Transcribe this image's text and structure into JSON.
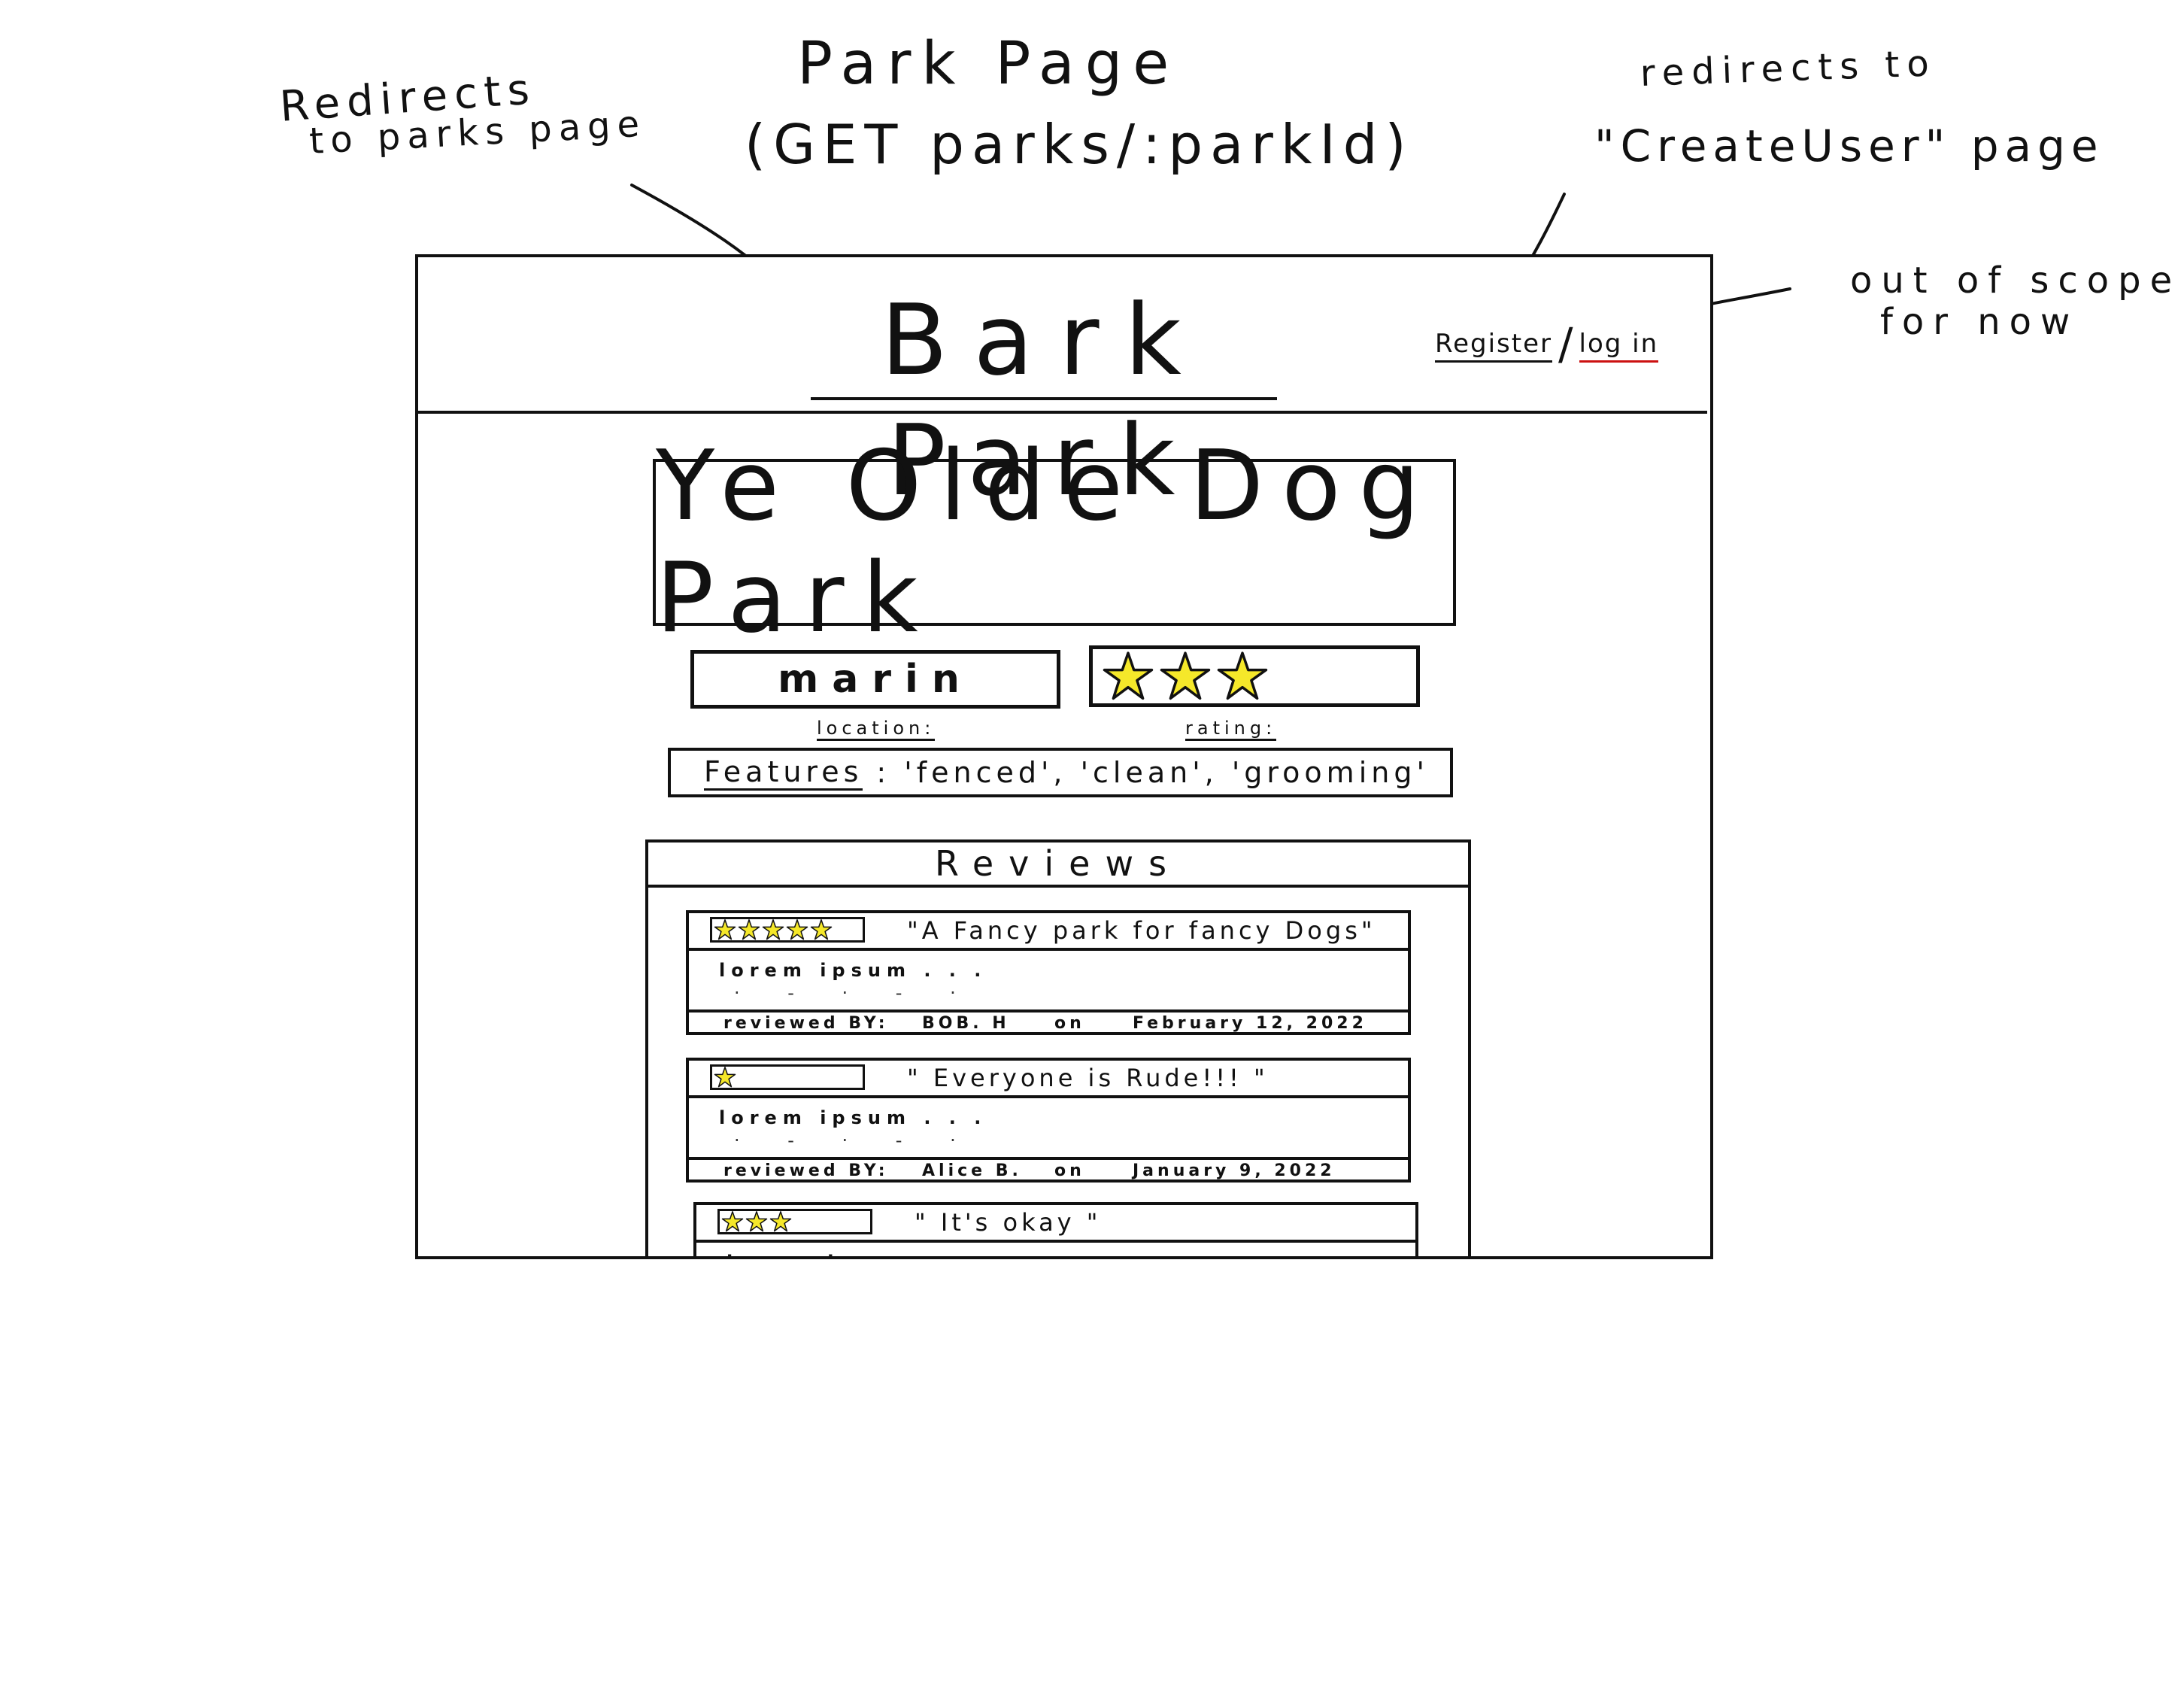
{
  "annotations": {
    "title_line1": "Park Page",
    "title_line2": "(GET parks/:parkId)",
    "left_line1": "Redirects",
    "left_line2": "to parks page",
    "right_line1": "redirects to",
    "right_line2": "\"CreateUser\" page",
    "scope_line1": "out of scope",
    "scope_line2": "for now"
  },
  "header": {
    "site_title": "Bark Park",
    "register_label": "Register",
    "separator": "/",
    "login_label": "log in",
    "login_underline_color": "#cc1111"
  },
  "park": {
    "name": "Ye Olde Dog Park",
    "location_value": "marin",
    "location_label": "location:",
    "rating_value": 3,
    "rating_label": "rating:",
    "features_label": "Features",
    "features_value": ": 'fenced', 'clean', 'grooming'"
  },
  "reviews": {
    "heading": "Reviews",
    "items": [
      {
        "stars": 5,
        "title": "\"A Fancy park for fancy Dogs\"",
        "body": "lorem ipsum . . .",
        "reviewed_by_label": "reviewed BY:",
        "author": "BOB. H",
        "on_label": "on",
        "date": "February 12, 2022"
      },
      {
        "stars": 1,
        "title": "\" Everyone is Rude!!! \"",
        "body": "lorem ipsum . . .",
        "reviewed_by_label": "reviewed BY:",
        "author": "Alice B.",
        "on_label": "on",
        "date": "January 9, 2022"
      },
      {
        "stars": 3,
        "title": "\" It's okay \"",
        "body": "lorem ipsum . . ."
      }
    ]
  },
  "colors": {
    "star_fill": "#f5e82a",
    "ink": "#111111"
  },
  "icons": {
    "rating_star": "star-icon",
    "annotation_arrow": "arrow-icon"
  }
}
